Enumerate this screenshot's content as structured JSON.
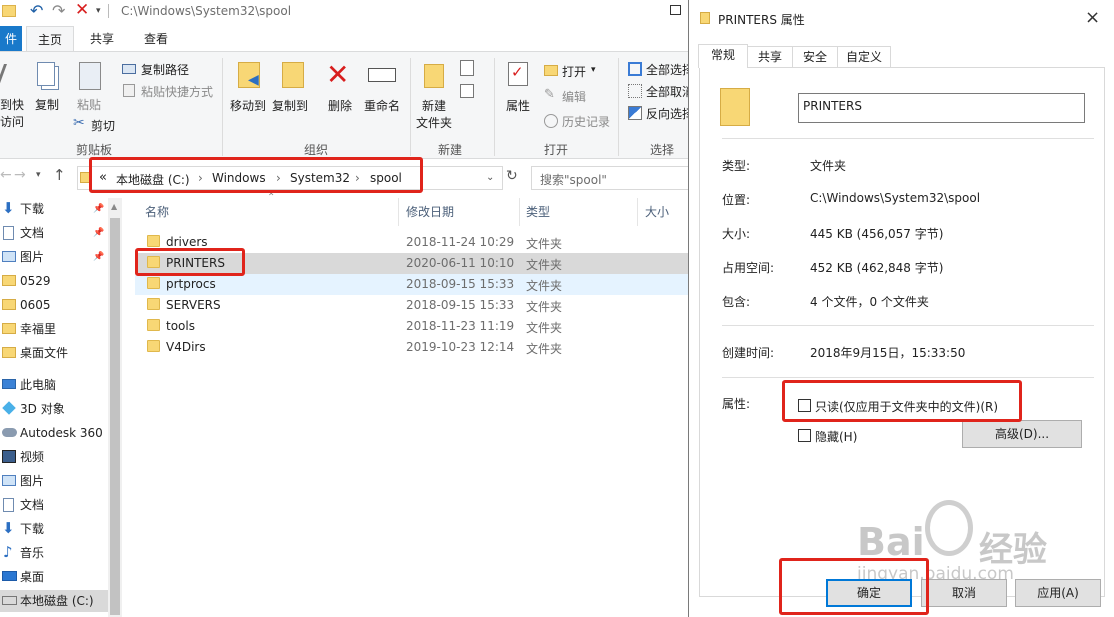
{
  "explorer": {
    "title_path": "C:\\Windows\\System32\\spool",
    "tabs": {
      "file": "件",
      "home": "主页",
      "share": "共享",
      "view": "查看"
    },
    "ribbon": {
      "pin_access_1": "到快",
      "pin_access_2": "访问",
      "copy": "复制",
      "paste": "粘贴",
      "copy_path": "复制路径",
      "paste_shortcut": "粘贴快捷方式",
      "cut": "剪切",
      "move_to": "移动到",
      "copy_to": "复制到",
      "delete": "删除",
      "rename": "重命名",
      "new_folder_1": "新建",
      "new_folder_2": "文件夹",
      "properties": "属性",
      "open": "打开",
      "edit": "编辑",
      "history": "历史记录",
      "select_all": "全部选择",
      "select_none": "全部取消",
      "invert": "反向选择",
      "groups": {
        "clipboard": "剪贴板",
        "organize": "组织",
        "new": "新建",
        "open": "打开",
        "select": "选择"
      }
    },
    "address": {
      "overflow": "«",
      "crumbs": [
        "本地磁盘 (C:)",
        "Windows",
        "System32",
        "spool"
      ],
      "search_placeholder": "搜索\"spool\""
    },
    "nav": [
      {
        "label": "下载",
        "icon": "download-arrow-icon"
      },
      {
        "label": "文档",
        "icon": "document-icon"
      },
      {
        "label": "图片",
        "icon": "picture-icon"
      },
      {
        "label": "0529",
        "icon": "folder-icon"
      },
      {
        "label": "0605",
        "icon": "folder-icon"
      },
      {
        "label": "幸福里",
        "icon": "folder-icon"
      },
      {
        "label": "桌面文件",
        "icon": "folder-icon"
      },
      {
        "label": "此电脑",
        "icon": "computer-icon"
      },
      {
        "label": "3D 对象",
        "icon": "cube-3d-icon"
      },
      {
        "label": "Autodesk 360",
        "icon": "cloud-icon"
      },
      {
        "label": "视频",
        "icon": "video-icon"
      },
      {
        "label": "图片",
        "icon": "picture-icon"
      },
      {
        "label": "文档",
        "icon": "document-icon"
      },
      {
        "label": "下载",
        "icon": "download-arrow-icon"
      },
      {
        "label": "音乐",
        "icon": "music-note-icon"
      },
      {
        "label": "桌面",
        "icon": "desktop-icon"
      },
      {
        "label": "本地磁盘 (C:)",
        "icon": "drive-icon"
      }
    ],
    "columns": {
      "name": "名称",
      "modified": "修改日期",
      "type": "类型",
      "size": "大小"
    },
    "files": [
      {
        "name": "drivers",
        "modified": "2018-11-24 10:29",
        "type": "文件夹"
      },
      {
        "name": "PRINTERS",
        "modified": "2020-06-11 10:10",
        "type": "文件夹"
      },
      {
        "name": "prtprocs",
        "modified": "2018-09-15 15:33",
        "type": "文件夹"
      },
      {
        "name": "SERVERS",
        "modified": "2018-09-15 15:33",
        "type": "文件夹"
      },
      {
        "name": "tools",
        "modified": "2018-11-23 11:19",
        "type": "文件夹"
      },
      {
        "name": "V4Dirs",
        "modified": "2019-10-23 12:14",
        "type": "文件夹"
      }
    ]
  },
  "dialog": {
    "title": "PRINTERS 属性",
    "close": "×",
    "tabs": [
      "常规",
      "共享",
      "安全",
      "自定义"
    ],
    "name_value": "PRINTERS",
    "type_label": "类型:",
    "type_value": "文件夹",
    "location_label": "位置:",
    "location_value": "C:\\Windows\\System32\\spool",
    "size_label": "大小:",
    "size_value": "445 KB (456,057 字节)",
    "disk_label": "占用空间:",
    "disk_value": "452 KB (462,848 字节)",
    "contains_label": "包含:",
    "contains_value": "4 个文件，0 个文件夹",
    "created_label": "创建时间:",
    "created_value": "2018年9月15日，15:33:50",
    "attr_label": "属性:",
    "readonly_label": "只读(仅应用于文件夹中的文件)(R)",
    "hidden_label": "隐藏(H)",
    "advanced": "高级(D)...",
    "ok": "确定",
    "cancel": "取消",
    "apply": "应用(A)"
  },
  "watermark": {
    "brand": "Bai",
    "brand2": "经验",
    "url": "jingyan.baidu.com"
  }
}
